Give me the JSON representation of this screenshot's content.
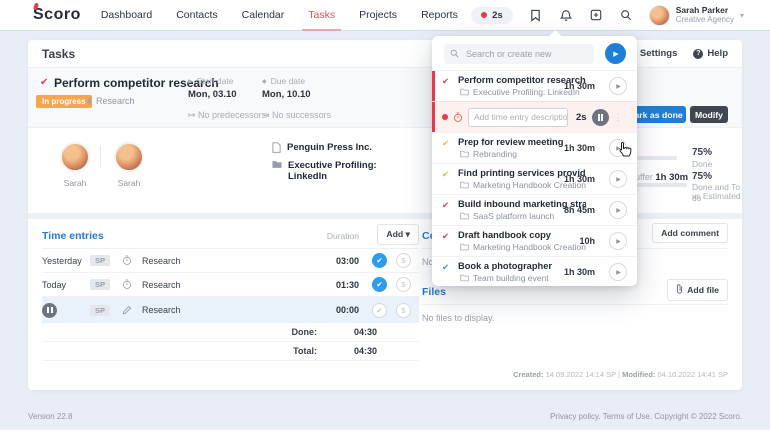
{
  "navbar": {
    "logo": "Scoro",
    "items": [
      "Dashboard",
      "Contacts",
      "Calendar",
      "Tasks",
      "Projects",
      "Reports"
    ],
    "more_label": "•••",
    "timer_value": "2s",
    "user": {
      "name": "Sarah Parker",
      "org": "Creative Agency"
    }
  },
  "page": {
    "title": "Tasks",
    "settings_label": "Settings",
    "help_label": "Help"
  },
  "task": {
    "title": "Perform competitor research",
    "status_badge": "In progress",
    "tag": "Research",
    "start_date_label": "Start date",
    "start_date": "Mon, 03.10",
    "due_date_label": "Due date",
    "due_date": "Mon, 10.10",
    "predecessors": "No predecessors",
    "successors": "No successors",
    "mark_done_label": "Mark as done",
    "modify_label": "Modify",
    "assignees": [
      {
        "name": "Sarah"
      },
      {
        "name": "Sarah"
      }
    ],
    "company": "Penguin Press Inc.",
    "project": "Executive Profiling: LinkedIn",
    "progress_done": {
      "value": "75%",
      "label": "Done"
    },
    "progress_buffer": {
      "buffer_label": "Buffer",
      "buffer_value": "1h 30m",
      "value": "75%",
      "label1": "Done and To do",
      "label2": "vs Estimated"
    }
  },
  "time_entries": {
    "title": "Time entries",
    "duration_label": "Duration",
    "add_label": "Add",
    "add_caret": "▾",
    "rows": [
      {
        "day": "Yesterday",
        "badge": "SP",
        "desc": "Research",
        "duration": "03:00"
      },
      {
        "day": "Today",
        "badge": "SP",
        "desc": "Research",
        "duration": "01:30"
      },
      {
        "day": "",
        "badge": "SP",
        "desc": "Research",
        "duration": "00:00"
      }
    ],
    "done_label": "Done:",
    "done_value": "04:30",
    "total_label": "Total:",
    "total_value": "04:30"
  },
  "comments": {
    "title": "Comments",
    "add_label": "Add comment",
    "empty": "No comments to display."
  },
  "files": {
    "title": "Files",
    "add_label": "Add file",
    "empty": "No files to display."
  },
  "dropdown": {
    "search_placeholder": "Search or create new",
    "timer_row": {
      "placeholder": "Add time entry description",
      "value": "2s",
      "kebab": "⋮"
    },
    "tasks": [
      {
        "title": "Perform competitor research",
        "project": "Executive Profiling: LinkedIn",
        "time": "1h 30m",
        "check": "#e8384f"
      },
      {
        "title": "Prep for review meeting",
        "project": "Rebranding",
        "time": "1h 30m",
        "check": "#f7b32b"
      },
      {
        "title": "Find printing services provider for ...",
        "project": "Marketing Handbook Creation",
        "time": "1h 30m",
        "check": "#f7b32b"
      },
      {
        "title": "Build inbound marketing strategy",
        "project": "SaaS platform launch",
        "time": "8h 45m",
        "check": "#e8384f"
      },
      {
        "title": "Draft handbook copy",
        "project": "Marketing Handbook Creation",
        "time": "10h",
        "check": "#e8384f"
      },
      {
        "title": "Book a photographer",
        "project": "Team building event",
        "time": "1h 30m",
        "check": "#2e9af0"
      }
    ]
  },
  "meta": {
    "created_label": "Created:",
    "created": "14.09.2022 14:14 SP",
    "sep": "|",
    "modified_label": "Modified:",
    "modified": "04.10.2022 14:41 SP"
  },
  "footer": {
    "version": "Version 22.8",
    "legal": "Privacy policy. Terms of Use. Copyright © 2022 Scoro."
  },
  "colors": {
    "accent_red": "#e8384f",
    "brand_blue": "#1d7fd8",
    "badge_orange": "#f9a450",
    "link_blue": "#2779d8"
  }
}
